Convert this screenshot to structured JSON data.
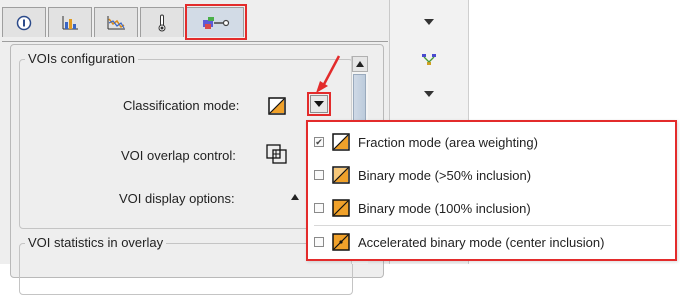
{
  "tabs": [
    {
      "icon": "info-icon",
      "active": false
    },
    {
      "icon": "bar-chart-icon",
      "active": false
    },
    {
      "icon": "line-chart-icon",
      "active": false
    },
    {
      "icon": "thermometer-icon",
      "active": false
    },
    {
      "icon": "voi-settings-icon",
      "active": true
    }
  ],
  "vois_config": {
    "title": "VOIs configuration",
    "classification_label": "Classification mode:",
    "overlap_label": "VOI overlap control:",
    "display_label": "VOI display options:"
  },
  "stats_group": {
    "title": "VOI statistics in overlay"
  },
  "classification_menu": {
    "items": [
      {
        "label": "Fraction mode (area weighting)",
        "checked": true,
        "icon": "fraction-mode-icon"
      },
      {
        "label": "Binary mode (>50% inclusion)",
        "checked": false,
        "icon": "binary-50-mode-icon"
      },
      {
        "label": "Binary mode (100% inclusion)",
        "checked": false,
        "icon": "binary-100-mode-icon"
      },
      {
        "label": "Accelerated binary mode (center inclusion)",
        "checked": false,
        "icon": "accelerated-binary-mode-icon"
      }
    ]
  },
  "colors": {
    "highlight": "#e32b2b",
    "orange_fill": "#f0a12a"
  }
}
